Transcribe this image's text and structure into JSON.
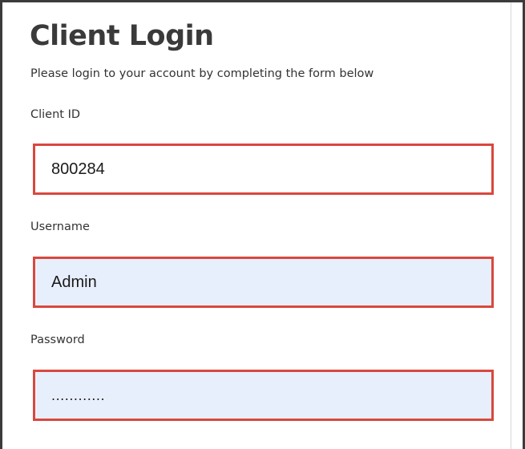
{
  "form": {
    "title": "Client Login",
    "subtitle": "Please login to your account by completing the form below",
    "client_id": {
      "label": "Client ID",
      "value": "800284"
    },
    "username": {
      "label": "Username",
      "value": "Admin"
    },
    "password": {
      "label": "Password",
      "value": "............"
    }
  },
  "colors": {
    "error_border": "#d9483e",
    "autofill_background": "#e8effc",
    "window_border": "#3b3b3b",
    "text": "#333333"
  }
}
